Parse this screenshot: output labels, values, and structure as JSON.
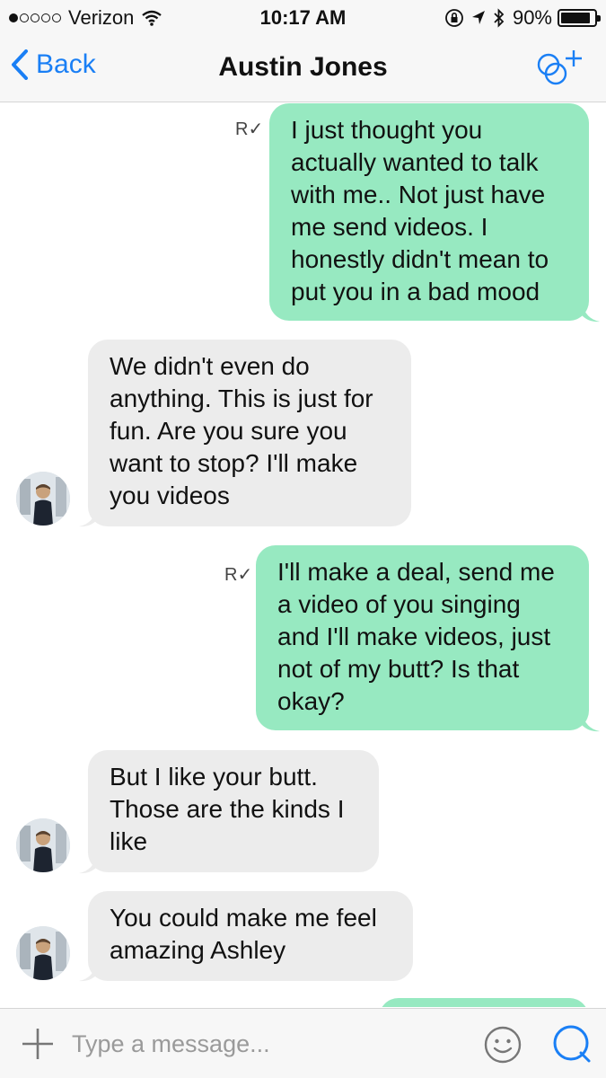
{
  "status_bar": {
    "carrier": "Verizon",
    "time": "10:17 AM",
    "battery_percent": "90%",
    "battery_level": 0.9,
    "signal_bars_filled": 1,
    "signal_bars_total": 5,
    "icons": [
      "wifi-icon",
      "rotation-lock-icon",
      "location-icon",
      "bluetooth-icon",
      "battery-icon"
    ]
  },
  "nav": {
    "back_label": "Back",
    "title": "Austin Jones",
    "add_icon": "add-contact-icon"
  },
  "messages": [
    {
      "direction": "outgoing",
      "receipt": "R✓",
      "text": [
        "I just thought you",
        "actually wanted to talk",
        "with me.. Not just have",
        "me send videos. I",
        "honestly didn't mean to",
        "put you in a bad mood"
      ]
    },
    {
      "direction": "incoming",
      "text": [
        "We didn't even do",
        "anything. This is just for",
        "fun. Are you sure you",
        "want to stop? I'll make",
        "you videos"
      ]
    },
    {
      "direction": "outgoing",
      "receipt": "R✓",
      "text": [
        "I'll make a deal, send me",
        "a video of you singing",
        "and I'll make videos, just",
        "not of my butt? Is that",
        "okay?"
      ]
    },
    {
      "direction": "incoming",
      "text": [
        "But I like your butt.",
        "Those are the kinds I",
        "like"
      ]
    },
    {
      "direction": "incoming",
      "text": [
        "You could make me feel",
        "amazing Ashley"
      ]
    }
  ],
  "input": {
    "placeholder": "Type a message...",
    "value": ""
  },
  "colors": {
    "outgoing_bubble": "#97e9c1",
    "incoming_bubble": "#ececec",
    "accent": "#1a7ff5"
  }
}
